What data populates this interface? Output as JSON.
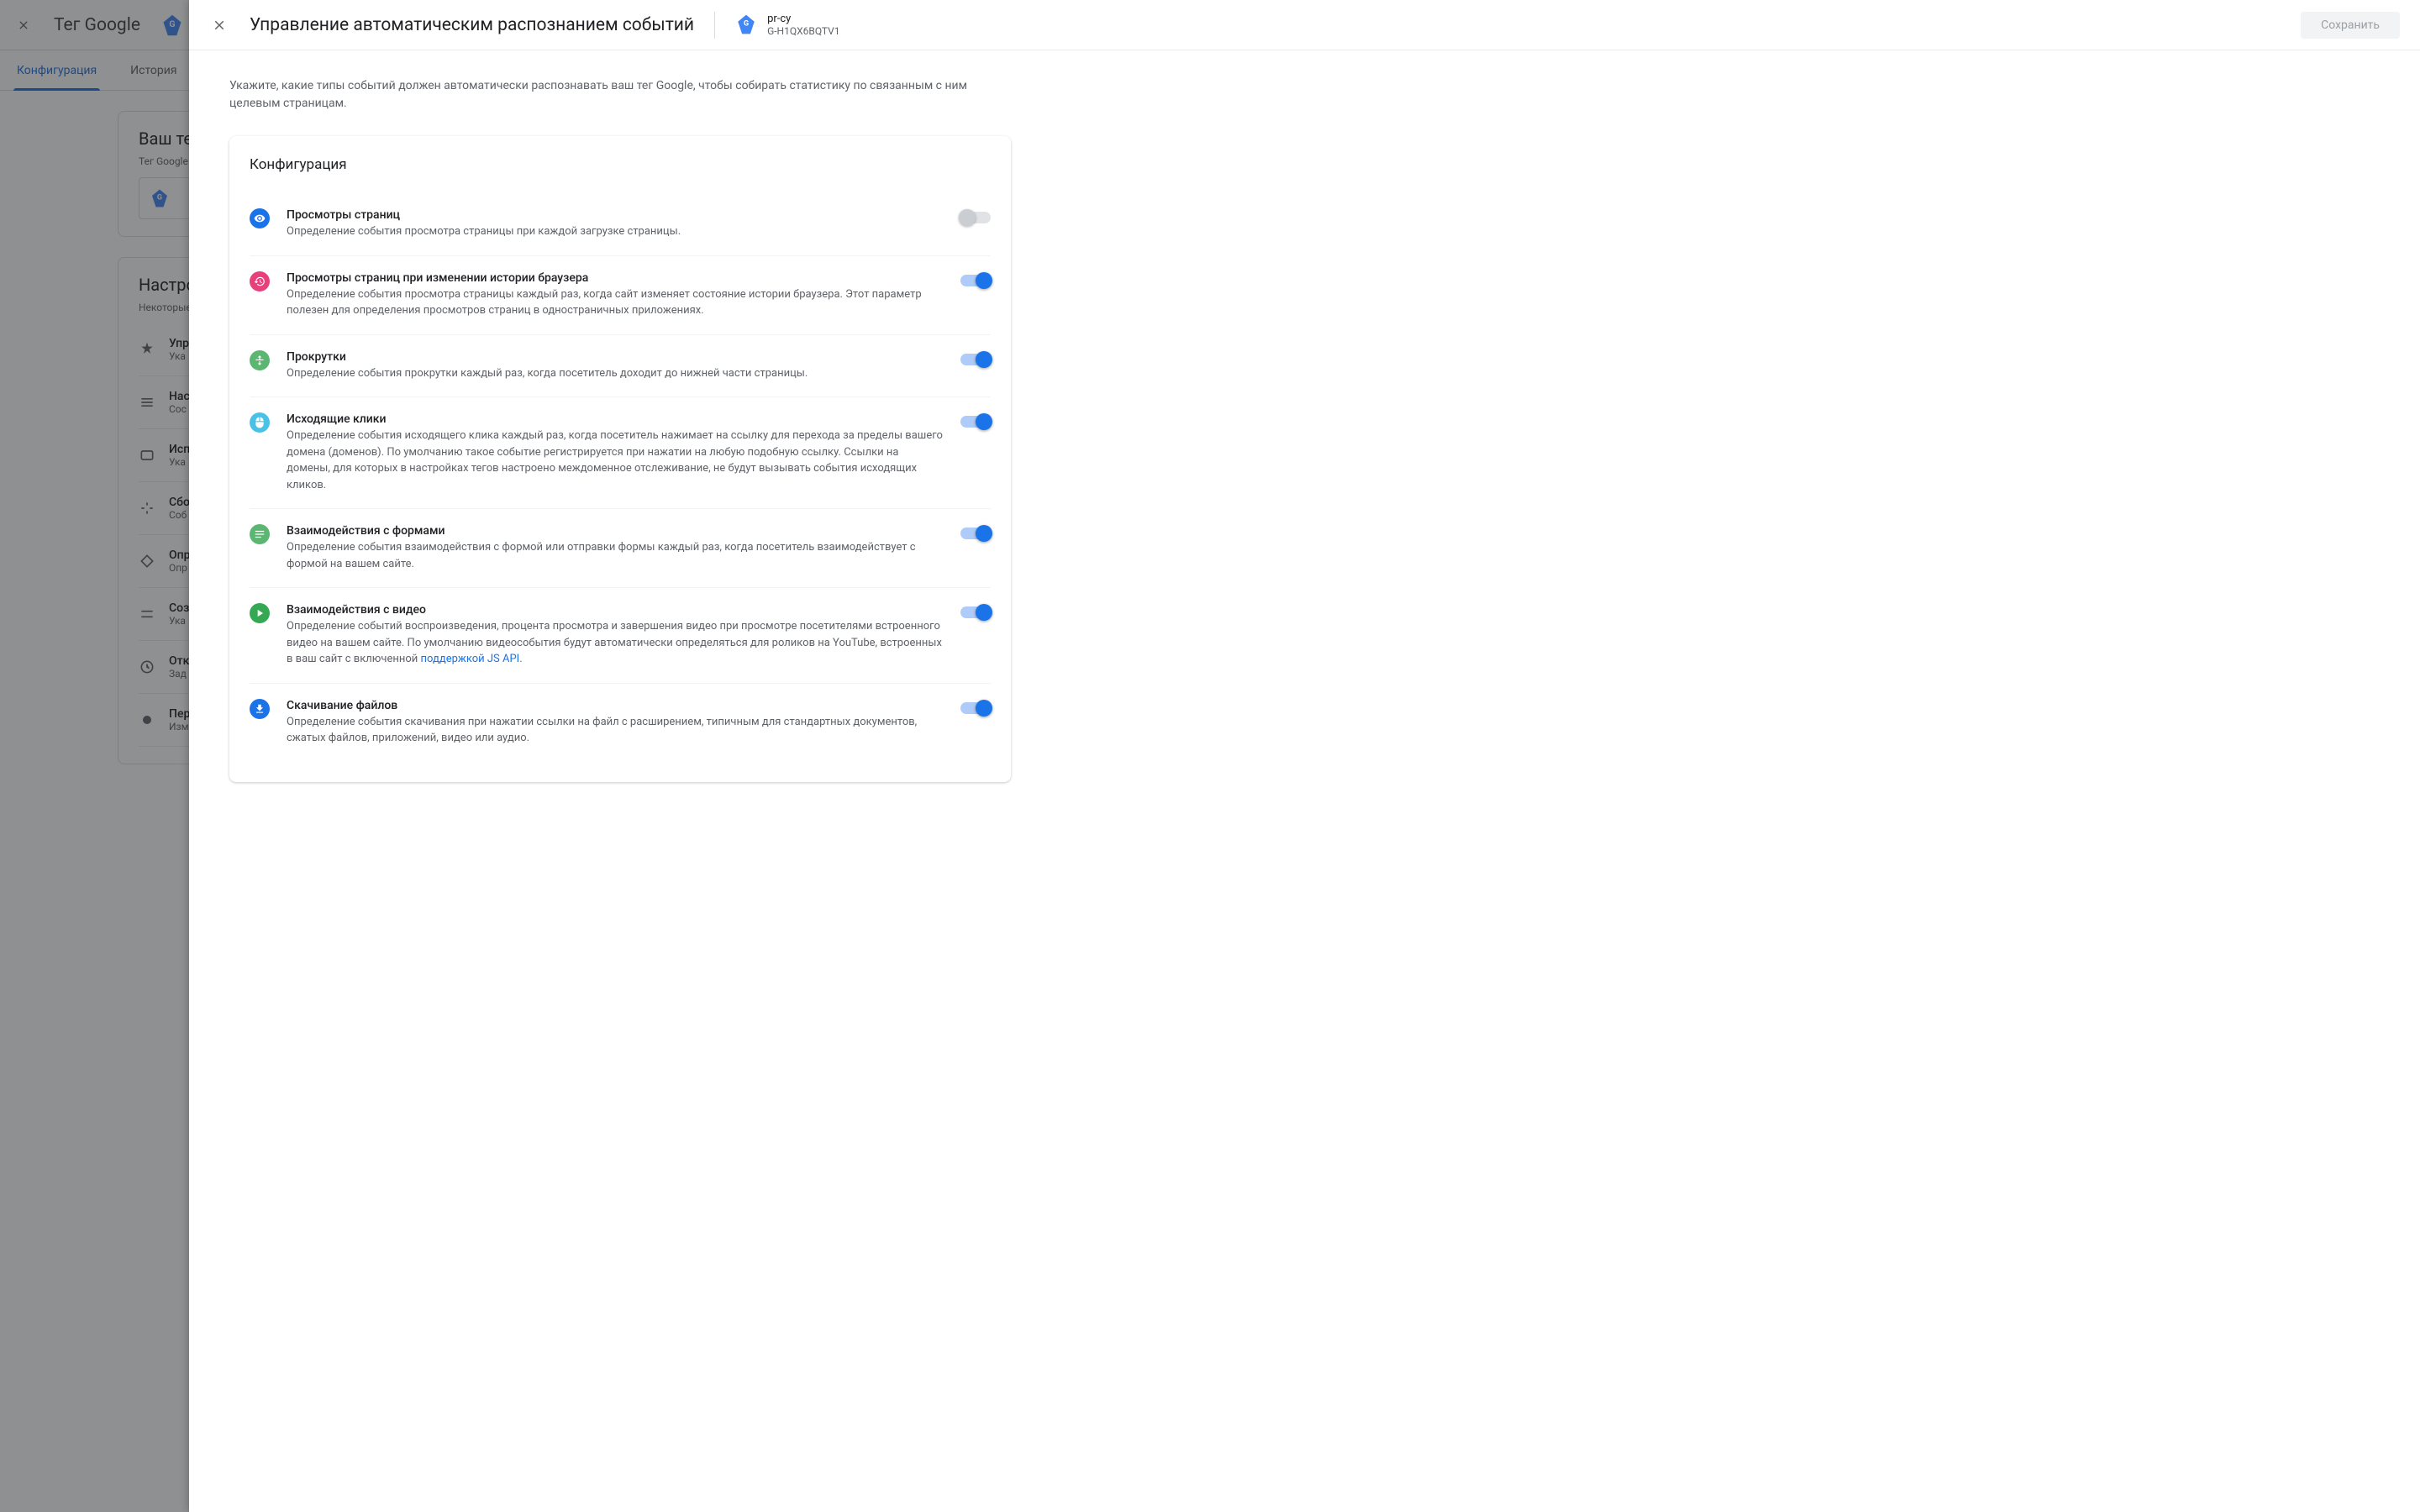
{
  "bg": {
    "page_title": "Тег Google",
    "tabs": {
      "config": "Конфигурация",
      "history": "История"
    },
    "card_tag_title": "Ваш тег G",
    "tag_label": "Тег Google",
    "settings_title": "Настройк",
    "settings_sub": "Некоторые н",
    "rows": {
      "0": {
        "title": "Упр",
        "desc": "Ука"
      },
      "1": {
        "title": "Нас",
        "desc": "Сос"
      },
      "2": {
        "title": "Исп",
        "desc": "Ука"
      },
      "3": {
        "title": "Сбо",
        "desc": "Соб"
      },
      "4": {
        "title": "Опр",
        "desc": "Опр"
      },
      "5": {
        "title": "Соз",
        "desc": "Ука"
      },
      "6": {
        "title": "Отк",
        "desc": "Зад"
      },
      "7": {
        "title": "Пер",
        "desc": "Изм"
      }
    }
  },
  "panel": {
    "title": "Управление автоматическим распознанием событий",
    "property_name": "pr-cy",
    "property_id": "G-H1QX6BQTV1",
    "save_label": "Сохранить",
    "intro": "Укажите, какие типы событий должен автоматически распознавать ваш тег Google, чтобы собирать статистику по связанным с ним целевым страницам.",
    "card_title": "Конфигурация"
  },
  "events": [
    {
      "title": "Просмотры страниц",
      "desc": "Определение события просмотра страницы при каждой загрузке страницы.",
      "enabled": false,
      "disabled_toggle": true,
      "icon": "i-eye"
    },
    {
      "title": "Просмотры страниц при изменении истории браузера",
      "desc": "Определение события просмотра страницы каждый раз, когда сайт изменяет состояние истории браузера. Этот параметр полезен для определения просмотров страниц в одностраничных приложениях.",
      "enabled": true,
      "icon": "i-history"
    },
    {
      "title": "Прокрутки",
      "desc": "Определение события прокрутки каждый раз, когда посетитель доходит до нижней части страницы.",
      "enabled": true,
      "icon": "i-scroll"
    },
    {
      "title": "Исходящие клики",
      "desc": "Определение события исходящего клика каждый раз, когда посетитель нажимает на ссылку для перехода за пределы вашего домена (доменов). По умолчанию такое событие регистрируется при нажатии на любую подобную ссылку. Ссылки на домены, для которых в настройках тегов настроено междоменное отслеживание, не будут вызывать события исходящих кликов.",
      "enabled": true,
      "icon": "i-click"
    },
    {
      "title": "Взаимодействия с формами",
      "desc": "Определение события взаимодействия с формой или отправки формы каждый раз, когда посетитель взаимодействует с формой на вашем сайте.",
      "enabled": true,
      "icon": "i-form"
    },
    {
      "title": "Взаимодействия с видео",
      "desc_before": "Определение событий воспроизведения, процента просмотра и завершения видео при просмотре посетителями встроенного видео на вашем сайте. По умолчанию видеособытия будут автоматически определяться для роликов на YouTube, встроенных в ваш сайт с включенной ",
      "link": "поддержкой JS API",
      "desc_after": ".",
      "enabled": true,
      "icon": "i-video"
    },
    {
      "title": "Скачивание файлов",
      "desc": "Определение события скачивания при нажатии ссылки на файл с расширением, типичным для стандартных документов, сжатых файлов, приложений, видео или аудио.",
      "enabled": true,
      "icon": "i-download"
    }
  ]
}
